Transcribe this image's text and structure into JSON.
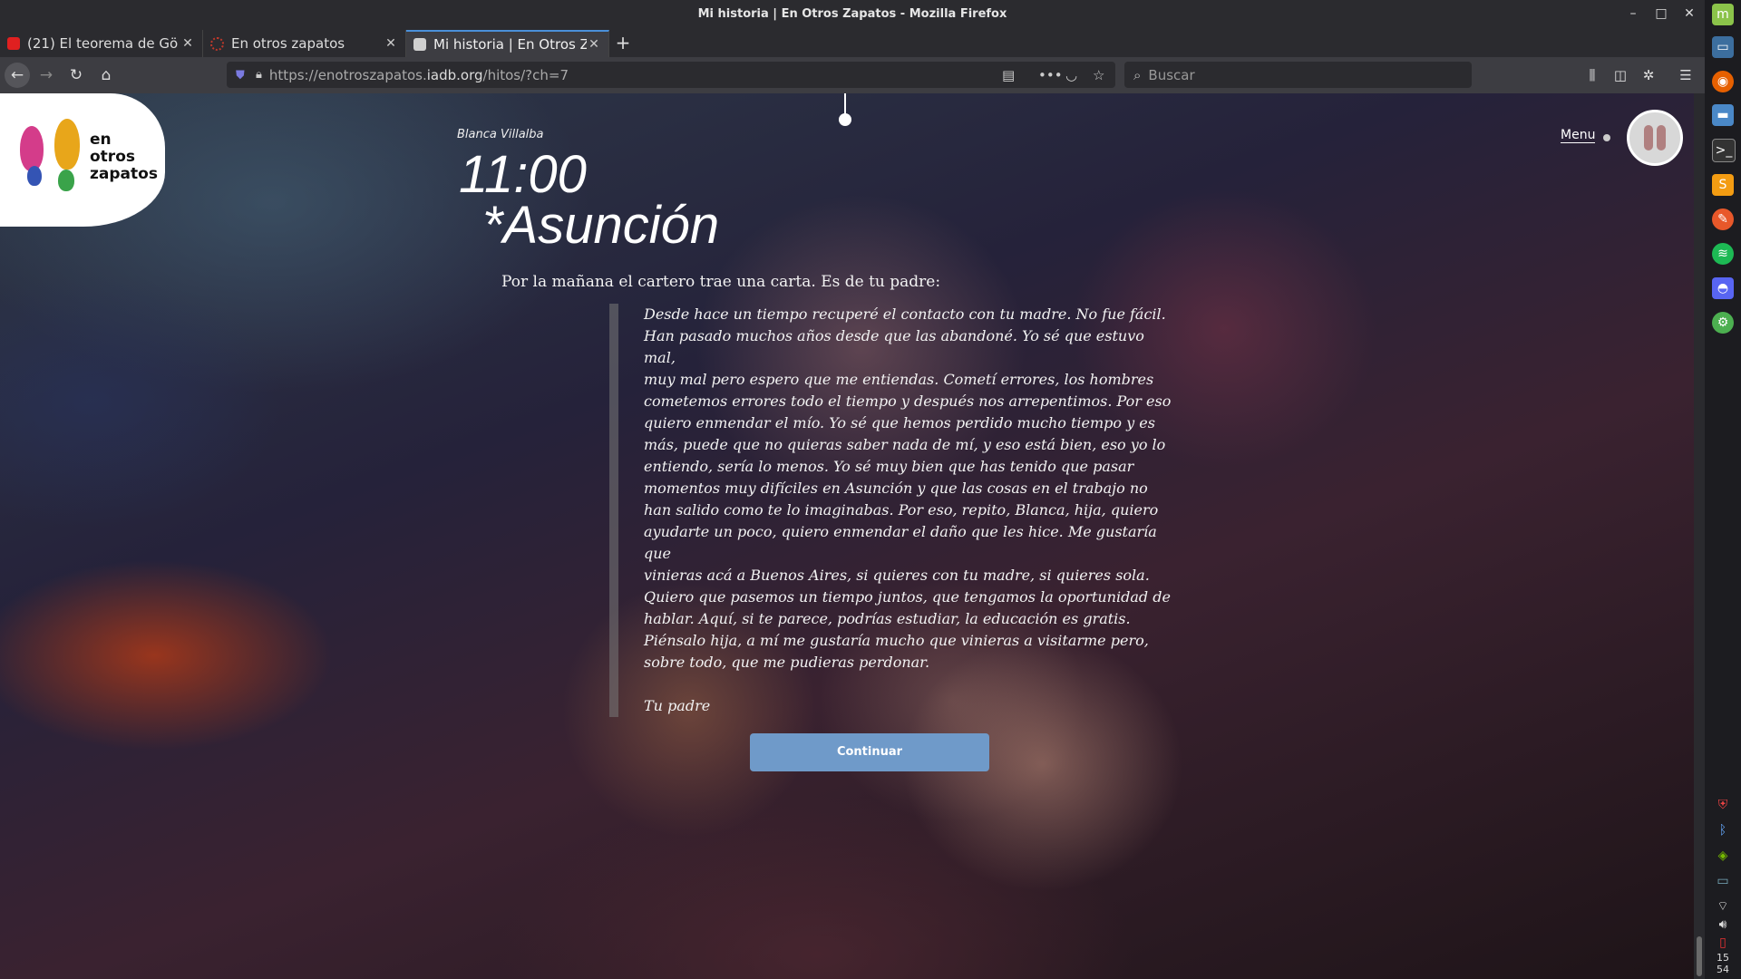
{
  "window": {
    "title": "Mi historia | En Otros Zapatos - Mozilla Firefox"
  },
  "tabs": [
    {
      "label": "(21) El teorema de Gö",
      "favicon_color": "#e02020",
      "active": false
    },
    {
      "label": "En otros zapatos",
      "favicon_color": "#c0392b",
      "active": false
    },
    {
      "label": "Mi historia | En Otros Z",
      "favicon_color": "#d0d0d0",
      "active": true
    }
  ],
  "navbar": {
    "url_prefix": "https://enotroszapatos.",
    "url_host": "iadb.org",
    "url_path": "/hitos/?ch=7",
    "search_placeholder": "Buscar"
  },
  "page": {
    "logo_text": {
      "line1": "en",
      "line2": "otros",
      "line3": "zapatos"
    },
    "author": "Blanca Villalba",
    "time": "11:00",
    "place": "*Asunción",
    "intro": "Por la mañana el cartero trae una carta. Es de tu padre:",
    "letter_lines": [
      "Desde hace un tiempo recuperé el contacto con tu madre. No fue fácil.",
      "Han pasado muchos años desde que las abandoné. Yo sé que estuvo mal,",
      "muy mal pero espero que me entiendas. Cometí errores, los hombres",
      "cometemos errores todo el tiempo y después nos arrepentimos. Por eso",
      "quiero enmendar el mío. Yo sé que hemos perdido mucho tiempo y es",
      "más, puede que no quieras saber nada de mí, y eso está bien, eso yo lo",
      "entiendo, sería lo menos. Yo sé muy bien que has tenido que pasar",
      "momentos muy difíciles en Asunción y que las cosas en el trabajo no",
      "han salido como te lo imaginabas. Por eso, repito, Blanca, hija, quiero",
      "ayudarte un poco, quiero enmendar el daño que les hice. Me gustaría que",
      "vinieras acá a Buenos Aires, si quieres con tu madre, si quieres sola.",
      "Quiero que pasemos un tiempo juntos, que tengamos la oportunidad de",
      "hablar. Aquí, si te parece, podrías estudiar, la educación es gratis.",
      "Piénsalo hija, a mí me gustaría mucho que vinieras a visitarme pero,",
      "sobre todo, que me pudieras perdonar."
    ],
    "signoff": "Tu padre",
    "continue_label": "Continuar",
    "menu_label": "Menu",
    "accent_color": "#6f9ac9"
  },
  "taskbar": {
    "icons": [
      "mint-menu-icon",
      "desktop-icon",
      "firefox-icon",
      "files-icon",
      "terminal-icon",
      "sublime-icon",
      "paint-icon",
      "spotify-icon",
      "discord-icon",
      "settings-icon"
    ],
    "tray": [
      "shield-icon",
      "bluetooth-icon",
      "nvidia-icon",
      "display-icon",
      "wifi-icon",
      "volume-icon",
      "battery-icon"
    ],
    "clock_hour": "15",
    "clock_minute": "54"
  }
}
